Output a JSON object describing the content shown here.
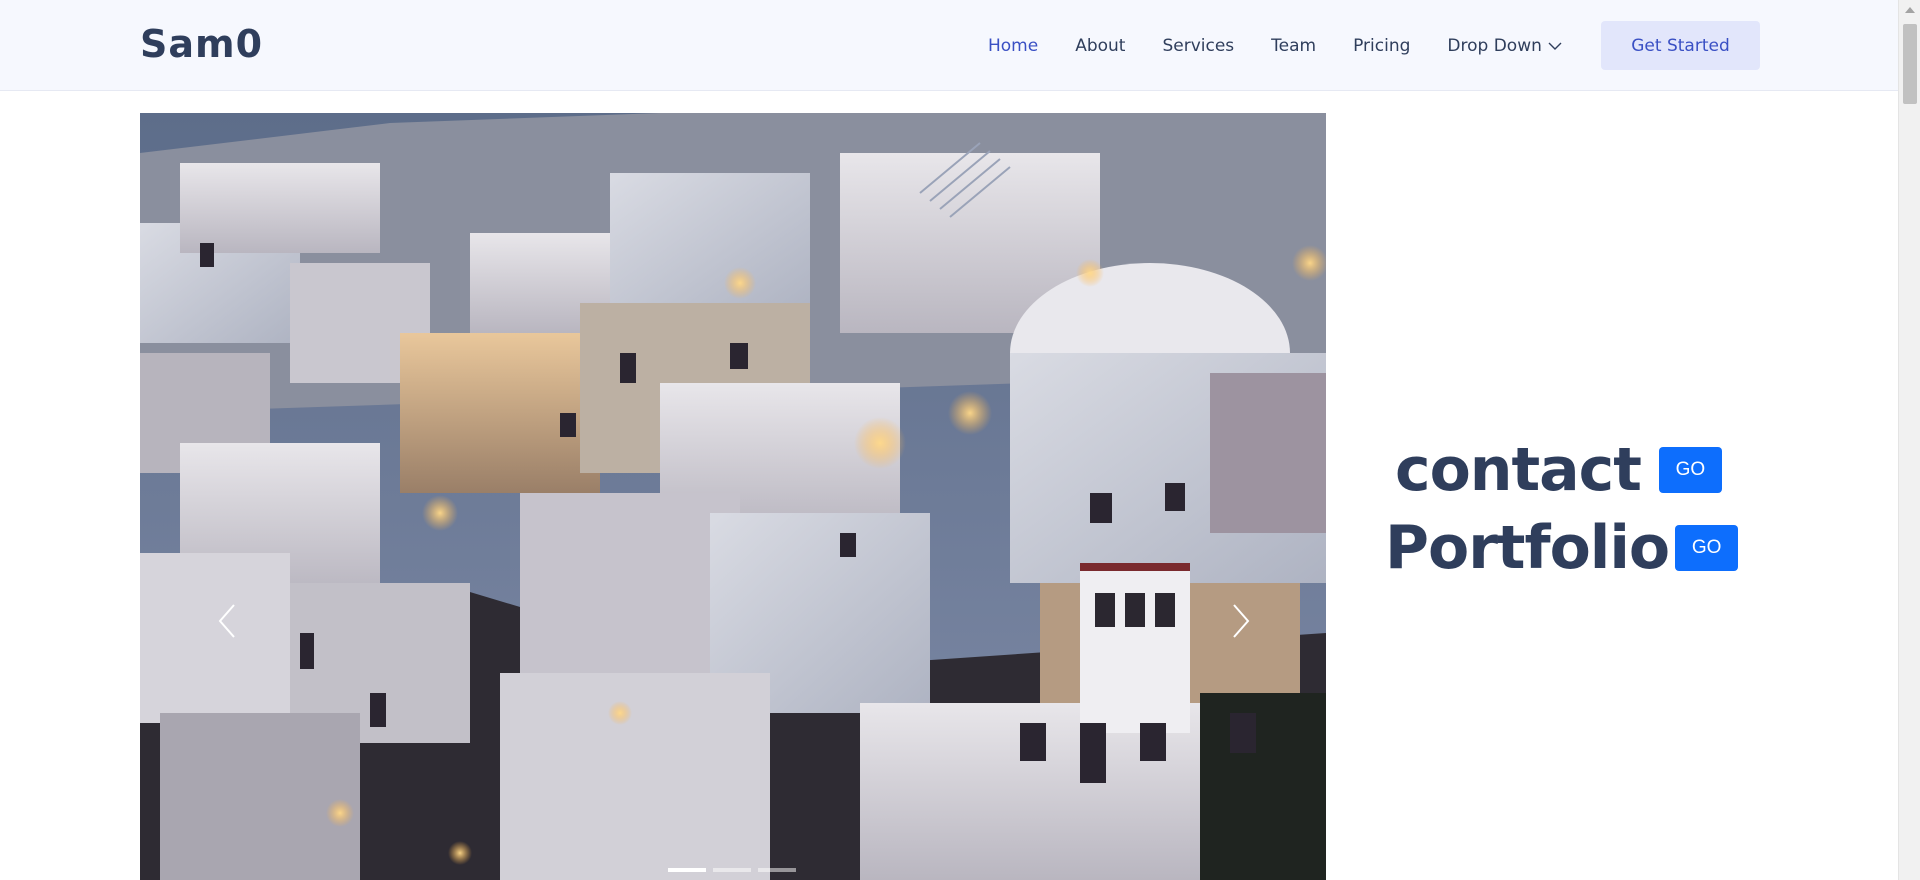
{
  "header": {
    "logo": "Sam0",
    "nav": [
      {
        "label": "Home",
        "active": true
      },
      {
        "label": "About",
        "active": false
      },
      {
        "label": "Services",
        "active": false
      },
      {
        "label": "Team",
        "active": false
      },
      {
        "label": "Pricing",
        "active": false
      }
    ],
    "dropdown": {
      "label": "Drop Down",
      "icon": "chevron-down-icon"
    },
    "cta_label": "Get Started"
  },
  "carousel": {
    "image_subject": "white hillside village at dusk",
    "prev_icon": "chevron-left-icon",
    "next_icon": "chevron-right-icon",
    "indicator_count": 3,
    "active_indicator": 0
  },
  "links": [
    {
      "label": "contact",
      "button": "GO"
    },
    {
      "label": "Portfolio",
      "button": "GO"
    }
  ],
  "colors": {
    "brand": "#2f3e5c",
    "accent": "#3a50c4",
    "go_button": "#0d6efd",
    "header_bg": "#f6f8fe"
  }
}
